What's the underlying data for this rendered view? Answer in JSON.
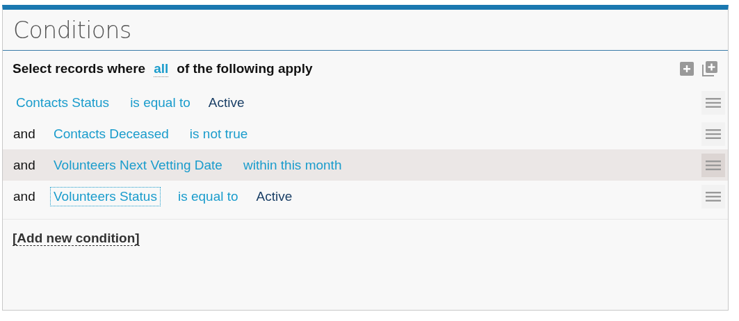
{
  "panel": {
    "title": "Conditions"
  },
  "header": {
    "prefix": "Select records where",
    "match": "all",
    "suffix": "of the following apply"
  },
  "conditions": [
    {
      "field": "Contacts Status",
      "operator": "is equal to",
      "value": "Active",
      "highlighted": false,
      "focused": false
    },
    {
      "conjunction": "and",
      "field": "Contacts Deceased",
      "operator": "is not true",
      "highlighted": false,
      "focused": false
    },
    {
      "conjunction": "and",
      "field": "Volunteers Next Vetting Date",
      "operator": "within this month",
      "highlighted": true,
      "focused": false
    },
    {
      "conjunction": "and",
      "field": "Volunteers Status",
      "operator": "is equal to",
      "value": "Active",
      "highlighted": false,
      "focused": true
    }
  ],
  "add_link": "[Add new condition]"
}
